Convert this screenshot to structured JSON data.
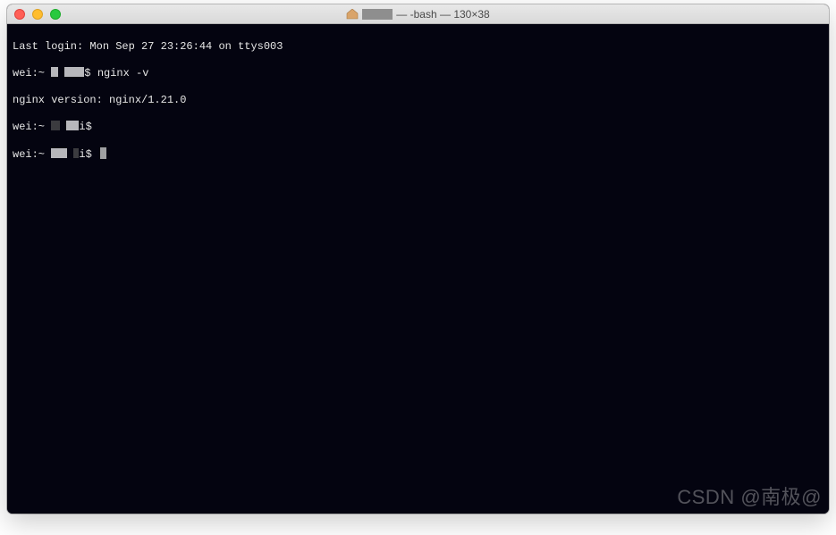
{
  "window": {
    "title_prefix": "",
    "title_shell": " — -bash — 130×38",
    "folder_icon": "home-folder-icon"
  },
  "terminal": {
    "lines": {
      "last_login": "Last login: Mon Sep 27 23:26:44 on ttys003",
      "prompt_host": "wei:~ ",
      "prompt_dollar": "$ ",
      "cmd1": "nginx -v",
      "output1": "nginx version: nginx/1.21.0",
      "prompt2_tail": "i$",
      "prompt3_tail": "i$ "
    }
  },
  "watermark": "CSDN @南极@"
}
